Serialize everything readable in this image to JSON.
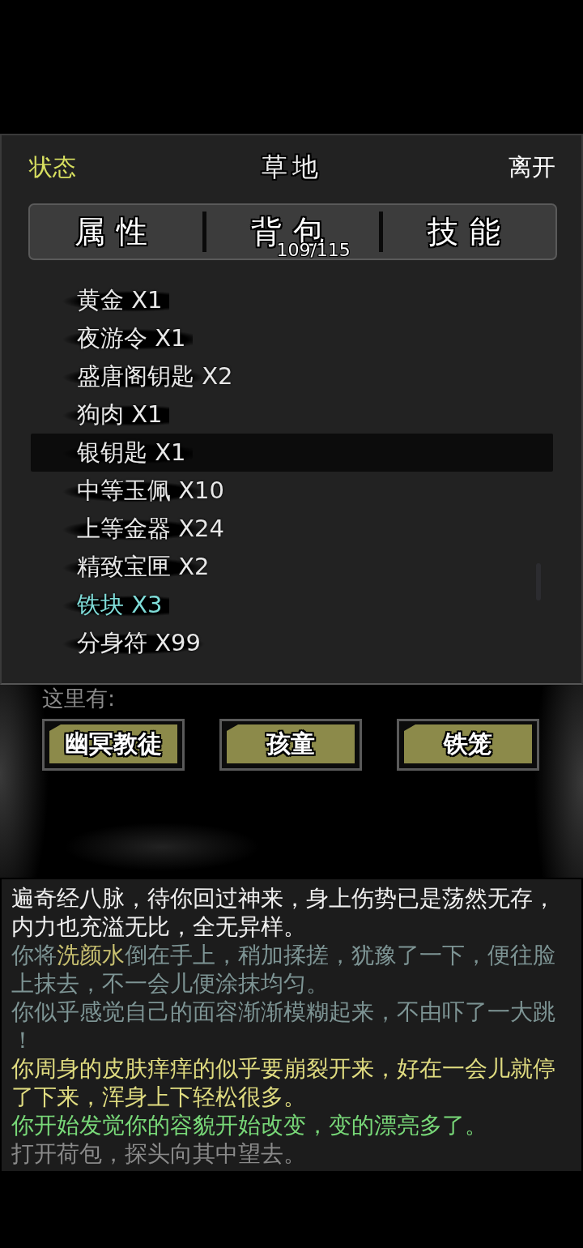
{
  "header": {
    "status": "状态",
    "location": "草地",
    "leave": "离开"
  },
  "tabs": [
    {
      "label": "属性"
    },
    {
      "label": "背包",
      "count": "109/115"
    },
    {
      "label": "技能"
    }
  ],
  "inventory": [
    {
      "name": "黄金 X1",
      "color": "#e8e8e8",
      "selected": false
    },
    {
      "name": "夜游令 X1",
      "color": "#e8e8e8",
      "selected": false
    },
    {
      "name": "盛唐阁钥匙 X2",
      "color": "#e8e8e8",
      "selected": false
    },
    {
      "name": "狗肉 X1",
      "color": "#e8e8e8",
      "selected": false
    },
    {
      "name": "银钥匙 X1",
      "color": "#e8e8e8",
      "selected": true
    },
    {
      "name": "中等玉佩 X10",
      "color": "#e8e8e8",
      "selected": false
    },
    {
      "name": "上等金器 X24",
      "color": "#e8e8e8",
      "selected": false
    },
    {
      "name": "精致宝匣 X2",
      "color": "#e8e8e8",
      "selected": false
    },
    {
      "name": "铁块 X3",
      "color": "#7fdcd8",
      "selected": false
    },
    {
      "name": "分身符 X99",
      "color": "#e8e8e8",
      "selected": false
    }
  ],
  "here": {
    "label": "这里有:",
    "buttons": [
      "幽冥教徒",
      "孩童",
      "铁笼"
    ]
  },
  "log": [
    {
      "parts": [
        {
          "text": "遍奇经八脉，待你回过神来，身上伤势已是荡然无存，内力也充溢无比，全无异样。",
          "color": "#f0f0f0"
        }
      ]
    },
    {
      "parts": [
        {
          "text": "你将",
          "color": "#7d9494"
        },
        {
          "text": "洗颜水",
          "color": "#c8c070"
        },
        {
          "text": "倒在手上，稍加揉搓，犹豫了一下，便往脸上抹去，不一会儿便涂抹均匀。",
          "color": "#7d9494"
        }
      ]
    },
    {
      "parts": [
        {
          "text": "你似乎感觉自己的面容渐渐模糊起来，不由吓了一大跳！",
          "color": "#7d9494"
        }
      ]
    },
    {
      "parts": [
        {
          "text": "你周身的皮肤痒痒的似乎要崩裂开来，好在一会儿就停了下来，浑身上下轻松很多。",
          "color": "#e0dc80"
        }
      ]
    },
    {
      "parts": [
        {
          "text": "你开始发觉你的容貌开始改变，变的漂亮多了。",
          "color": "#78d878"
        }
      ]
    },
    {
      "parts": [
        {
          "text": "打开荷包，探头向其中望去。",
          "color": "#8a8a8a"
        }
      ]
    }
  ]
}
